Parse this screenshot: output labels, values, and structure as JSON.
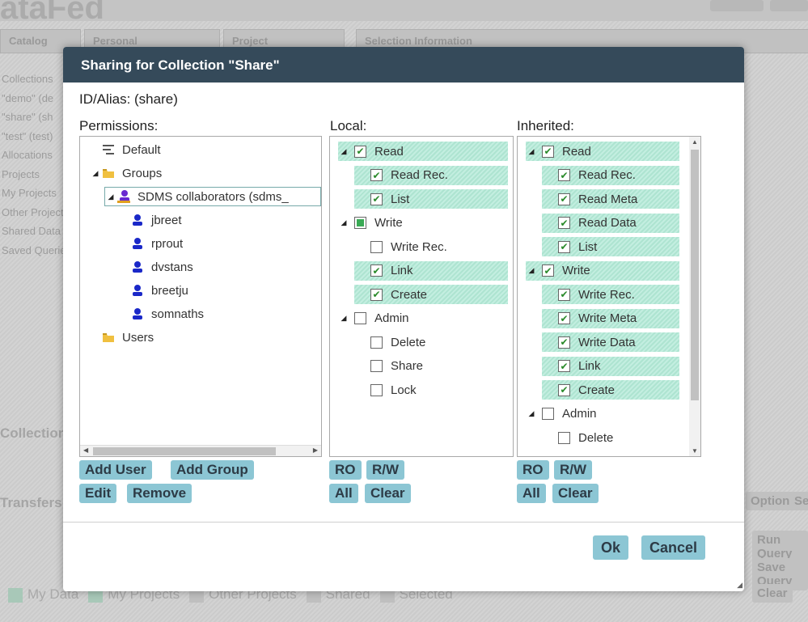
{
  "background": {
    "brand": "ataFed",
    "tabs": [
      "Catalog",
      "Personal",
      "Project",
      "Selection Information"
    ],
    "side_items": [
      "Collections",
      "\"demo\" (de",
      "\"share\" (sh",
      "\"test\" (test)",
      "Allocations",
      "Projects",
      "My Projects",
      "Other Projects",
      "Shared Data",
      "",
      "Saved Queries"
    ],
    "section_collection": "Collection",
    "section_transfer": "Transfers",
    "filters": [
      "My Data",
      "My Projects",
      "Other Projects",
      "Shared",
      "Selected"
    ],
    "right_buttons": [
      "Run Query",
      "Save Query",
      "Clear"
    ],
    "right_tabs": [
      "Options",
      "Se"
    ]
  },
  "dialog": {
    "title": "Sharing for Collection \"Share\"",
    "id_alias": "ID/Alias: (share)",
    "permissions_label": "Permissions:",
    "local_label": "Local:",
    "inherited_label": "Inherited:",
    "permissions_tree": [
      {
        "label": "Default",
        "icon": "default-list-icon",
        "indent": 0
      },
      {
        "label": "Groups",
        "icon": "folder-icon",
        "indent": 0,
        "expanded": true
      },
      {
        "label": "SDMS collaborators (sdms_",
        "icon": "group-user-icon",
        "indent": 1,
        "expanded": true,
        "selected": true
      },
      {
        "label": "jbreet",
        "icon": "user-icon",
        "indent": 2
      },
      {
        "label": "rprout",
        "icon": "user-icon",
        "indent": 2
      },
      {
        "label": "dvstans",
        "icon": "user-icon",
        "indent": 2
      },
      {
        "label": "breetju",
        "icon": "user-icon",
        "indent": 2
      },
      {
        "label": "somnaths",
        "icon": "user-icon",
        "indent": 2
      },
      {
        "label": "Users",
        "icon": "folder-icon",
        "indent": 0
      }
    ],
    "local_perms": [
      {
        "label": "Read",
        "group": true,
        "state": "checked",
        "hl": true
      },
      {
        "label": "Read Rec.",
        "state": "checked",
        "hl": true
      },
      {
        "label": "List",
        "state": "checked",
        "hl": true
      },
      {
        "label": "Write",
        "group": true,
        "state": "partial",
        "hl": false
      },
      {
        "label": "Write Rec.",
        "state": "unchecked",
        "hl": false
      },
      {
        "label": "Link",
        "state": "checked",
        "hl": true
      },
      {
        "label": "Create",
        "state": "checked",
        "hl": true
      },
      {
        "label": "Admin",
        "group": true,
        "state": "unchecked",
        "hl": false
      },
      {
        "label": "Delete",
        "state": "unchecked",
        "hl": false
      },
      {
        "label": "Share",
        "state": "unchecked",
        "hl": false
      },
      {
        "label": "Lock",
        "state": "unchecked",
        "hl": false
      }
    ],
    "inherited_perms": [
      {
        "label": "Read",
        "group": true,
        "state": "checked",
        "hl": true
      },
      {
        "label": "Read Rec.",
        "state": "checked",
        "hl": true
      },
      {
        "label": "Read Meta",
        "state": "checked",
        "hl": true
      },
      {
        "label": "Read Data",
        "state": "checked",
        "hl": true
      },
      {
        "label": "List",
        "state": "checked",
        "hl": true
      },
      {
        "label": "Write",
        "group": true,
        "state": "checked",
        "hl": true
      },
      {
        "label": "Write Rec.",
        "state": "checked",
        "hl": true
      },
      {
        "label": "Write Meta",
        "state": "checked",
        "hl": true
      },
      {
        "label": "Write Data",
        "state": "checked",
        "hl": true
      },
      {
        "label": "Link",
        "state": "checked",
        "hl": true
      },
      {
        "label": "Create",
        "state": "checked",
        "hl": true
      },
      {
        "label": "Admin",
        "group": true,
        "state": "unchecked",
        "hl": false
      },
      {
        "label": "Delete",
        "state": "unchecked",
        "hl": false
      }
    ],
    "buttons": {
      "add_user": "Add User",
      "add_group": "Add Group",
      "edit": "Edit",
      "remove": "Remove",
      "ro": "RO",
      "rw": "R/W",
      "all": "All",
      "clear": "Clear",
      "ok": "Ok",
      "cancel": "Cancel"
    },
    "colors": {
      "title_bar": "#354a5a",
      "button": "#8cc6d4",
      "highlight": "#b5e8d7",
      "user_icon": "#1a28c8",
      "folder_icon": "#f0c040"
    }
  }
}
